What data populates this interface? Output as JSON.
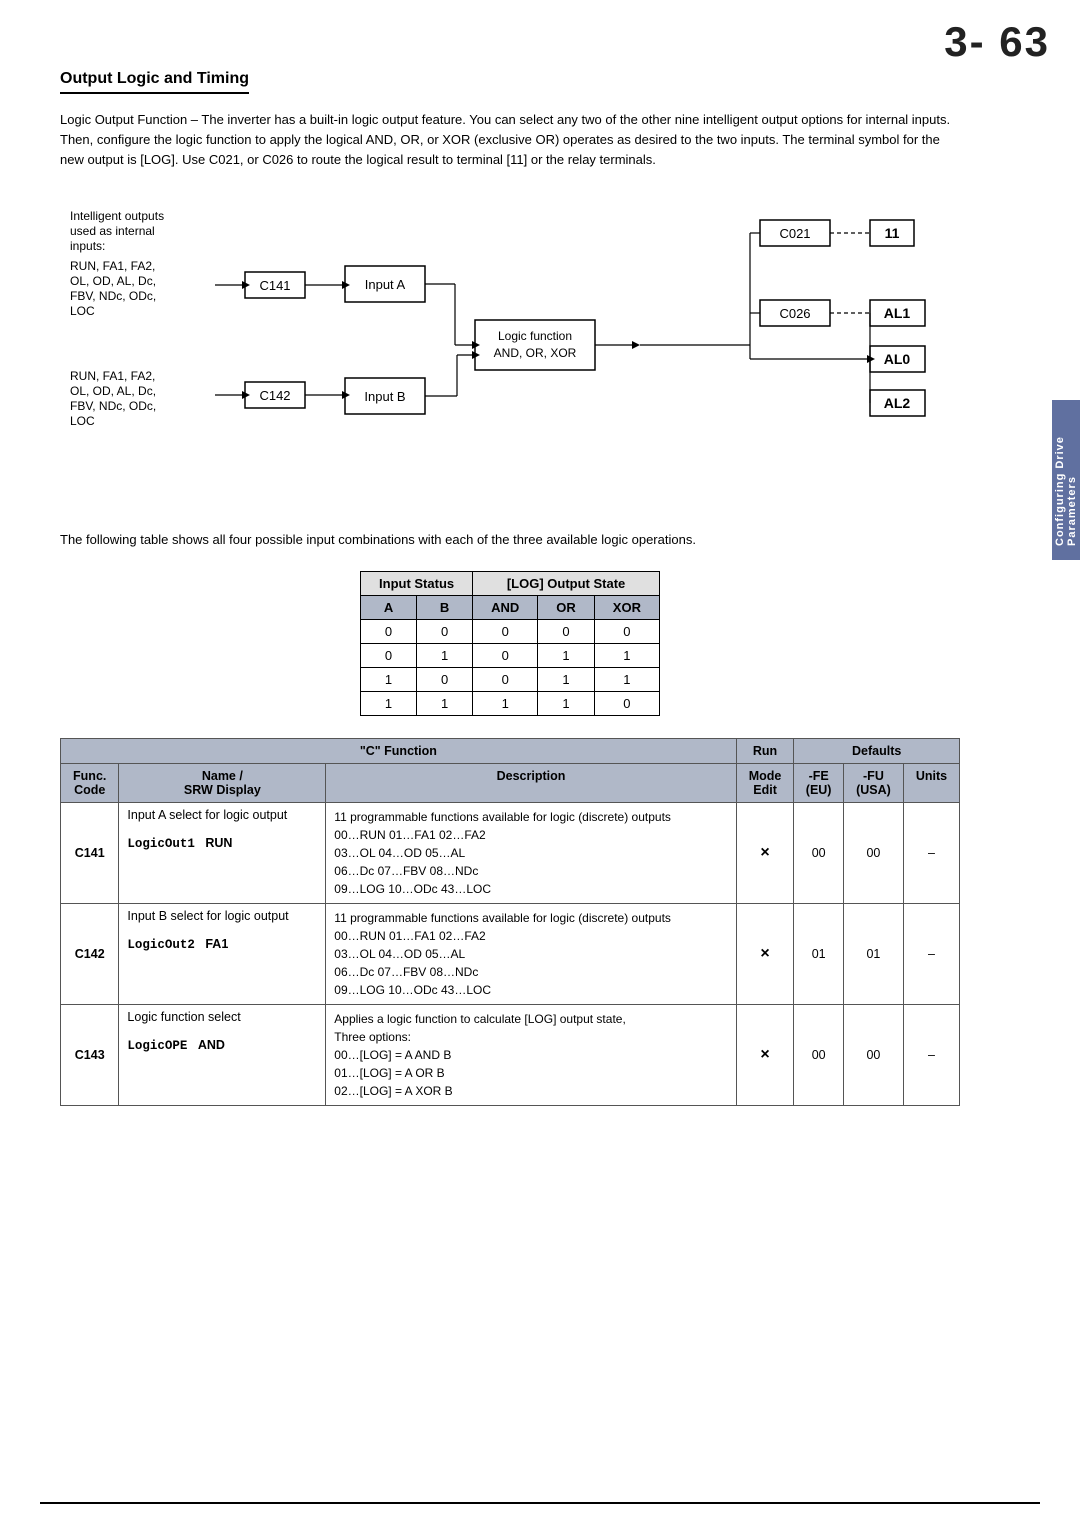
{
  "page_number": "3- 63",
  "section_title": "Output Logic and Timing",
  "body_text": "Logic Output Function – The inverter has a built-in logic output feature. You can select any two of the other nine intelligent output options for internal inputs. Then, configure the logic function to apply the logical AND, OR, or XOR (exclusive OR) operates as desired to the two inputs. The terminal symbol for the new output is [LOG]. Use C021, or C026 to route the logical result to terminal [11] or the relay terminals.",
  "diagram": {
    "label_inputs": "Intelligent outputs used as internal inputs:",
    "label_inputs_list": "RUN, FA1, FA2, OL, OD, AL, Dc, FBV, NDc, ODc, LOC",
    "label_c141": "C141",
    "label_c142": "C142",
    "label_input_a": "Input A",
    "label_input_b": "Input B",
    "label_logic_func": "Logic function AND, OR, XOR",
    "label_c021": "C021",
    "label_c026": "C026",
    "label_11": "11",
    "label_al1": "AL1",
    "label_al0": "AL0",
    "label_al2": "AL2"
  },
  "table_intro": "The following table shows all four possible input combinations with each of the three available logic operations.",
  "logic_table": {
    "header1": [
      "Input Status",
      "[LOG] Output State"
    ],
    "header2": [
      "A",
      "B",
      "AND",
      "OR",
      "XOR"
    ],
    "rows": [
      [
        "0",
        "0",
        "0",
        "0",
        "0"
      ],
      [
        "0",
        "1",
        "0",
        "1",
        "1"
      ],
      [
        "1",
        "0",
        "0",
        "1",
        "1"
      ],
      [
        "1",
        "1",
        "1",
        "1",
        "0"
      ]
    ]
  },
  "func_table": {
    "section_header": "\"C\" Function",
    "run_header": "Run",
    "defaults_header": "Defaults",
    "col_func": "Func. Code",
    "col_name": "Name / SRW Display",
    "col_desc": "Description",
    "col_mode": "Mode Edit",
    "col_fe": "-FE (EU)",
    "col_fu": "-FU (USA)",
    "col_units": "Units",
    "rows": [
      {
        "code": "C141",
        "name": "Input A select for logic output",
        "srw": "LogicOut1",
        "srw_suffix": "RUN",
        "description": "11 programmable functions available for logic (discrete) outputs\n00…RUN    01…FA1    02…FA2\n03…OL     04…OD     05…AL\n06…Dc     07…FBV    08…NDc\n09…LOG    10…ODc    43…LOC",
        "run_mode": "×",
        "fe": "00",
        "fu": "00",
        "units": "–"
      },
      {
        "code": "C142",
        "name": "Input B select for logic output",
        "srw": "LogicOut2",
        "srw_suffix": "FA1",
        "description": "11 programmable functions available for logic (discrete) outputs\n00…RUN    01…FA1    02…FA2\n03…OL     04…OD     05…AL\n06…Dc     07…FBV    08…NDc\n09…LOG    10…ODc    43…LOC",
        "run_mode": "×",
        "fe": "01",
        "fu": "01",
        "units": "–"
      },
      {
        "code": "C143",
        "name": "Logic function select",
        "srw": "LogicOPE",
        "srw_suffix": "AND",
        "description": "Applies a logic function to calculate [LOG] output state,\nThree options:\n00…[LOG] = A AND B\n01…[LOG] = A OR B\n02…[LOG] = A XOR B",
        "run_mode": "×",
        "fe": "00",
        "fu": "00",
        "units": "–"
      }
    ]
  },
  "side_tab": "Configuring Drive Parameters"
}
